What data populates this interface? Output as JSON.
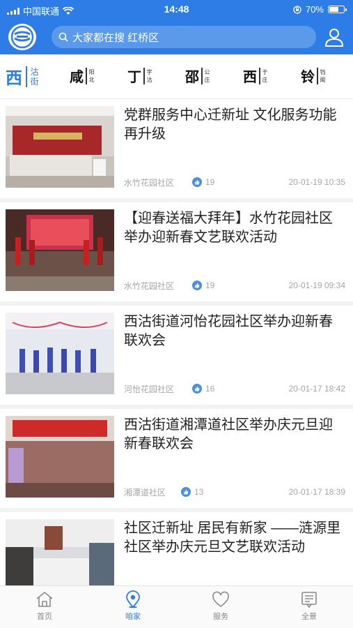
{
  "status_bar": {
    "carrier": "中国联通",
    "time": "14:48",
    "battery": "70%",
    "battery_level": 0.7
  },
  "header": {
    "logo_icon": "community-logo-icon",
    "search_placeholder": "大家都在搜 红桥区",
    "user_icon": "user-icon"
  },
  "streets": {
    "logo": {
      "big": "西",
      "small_top": "沽",
      "small_bottom": "街"
    },
    "items": [
      {
        "big": "咸",
        "small_top": "阳",
        "small_bottom": "北"
      },
      {
        "big": "丁",
        "small_top": "字",
        "small_bottom": "沽"
      },
      {
        "big": "邵",
        "small_top": "公",
        "small_bottom": "庄"
      },
      {
        "big": "西",
        "small_top": "于",
        "small_bottom": "庄"
      },
      {
        "big": "铃",
        "small_top": "铛",
        "small_bottom": "阁"
      }
    ]
  },
  "news": [
    {
      "title": "党群服务中心迁新址 文化服务功能再升级",
      "source": "水竹花园社区",
      "likes": "19",
      "date": "20-01-19 10:35"
    },
    {
      "title": "【迎春送福大拜年】水竹花园社区举办迎新春文艺联欢活动",
      "source": "水竹花园社区",
      "likes": "19",
      "date": "20-01-19 09:34"
    },
    {
      "title": "西沽街道河怡花园社区举办迎新春联欢会",
      "source": "河怡花园社区",
      "likes": "16",
      "date": "20-01-17 18:42"
    },
    {
      "title": "西沽街道湘潭道社区举办庆元旦迎新春联欢会",
      "source": "湘潭道社区",
      "likes": "13",
      "date": "20-01-17 18:39"
    },
    {
      "title": "社区迁新址 居民有新家 ——涟源里社区举办庆元旦文艺联欢活动",
      "source": "",
      "likes": "",
      "date": ""
    }
  ],
  "tabbar": [
    {
      "label": "首页",
      "icon": "home-icon",
      "active": false
    },
    {
      "label": "咱家",
      "icon": "location-pin-icon",
      "active": true
    },
    {
      "label": "服务",
      "icon": "heart-icon",
      "active": false
    },
    {
      "label": "全景",
      "icon": "panorama-icon",
      "active": false
    }
  ],
  "colors": {
    "brand": "#2e7de6",
    "like_icon": "#4a90e2"
  }
}
